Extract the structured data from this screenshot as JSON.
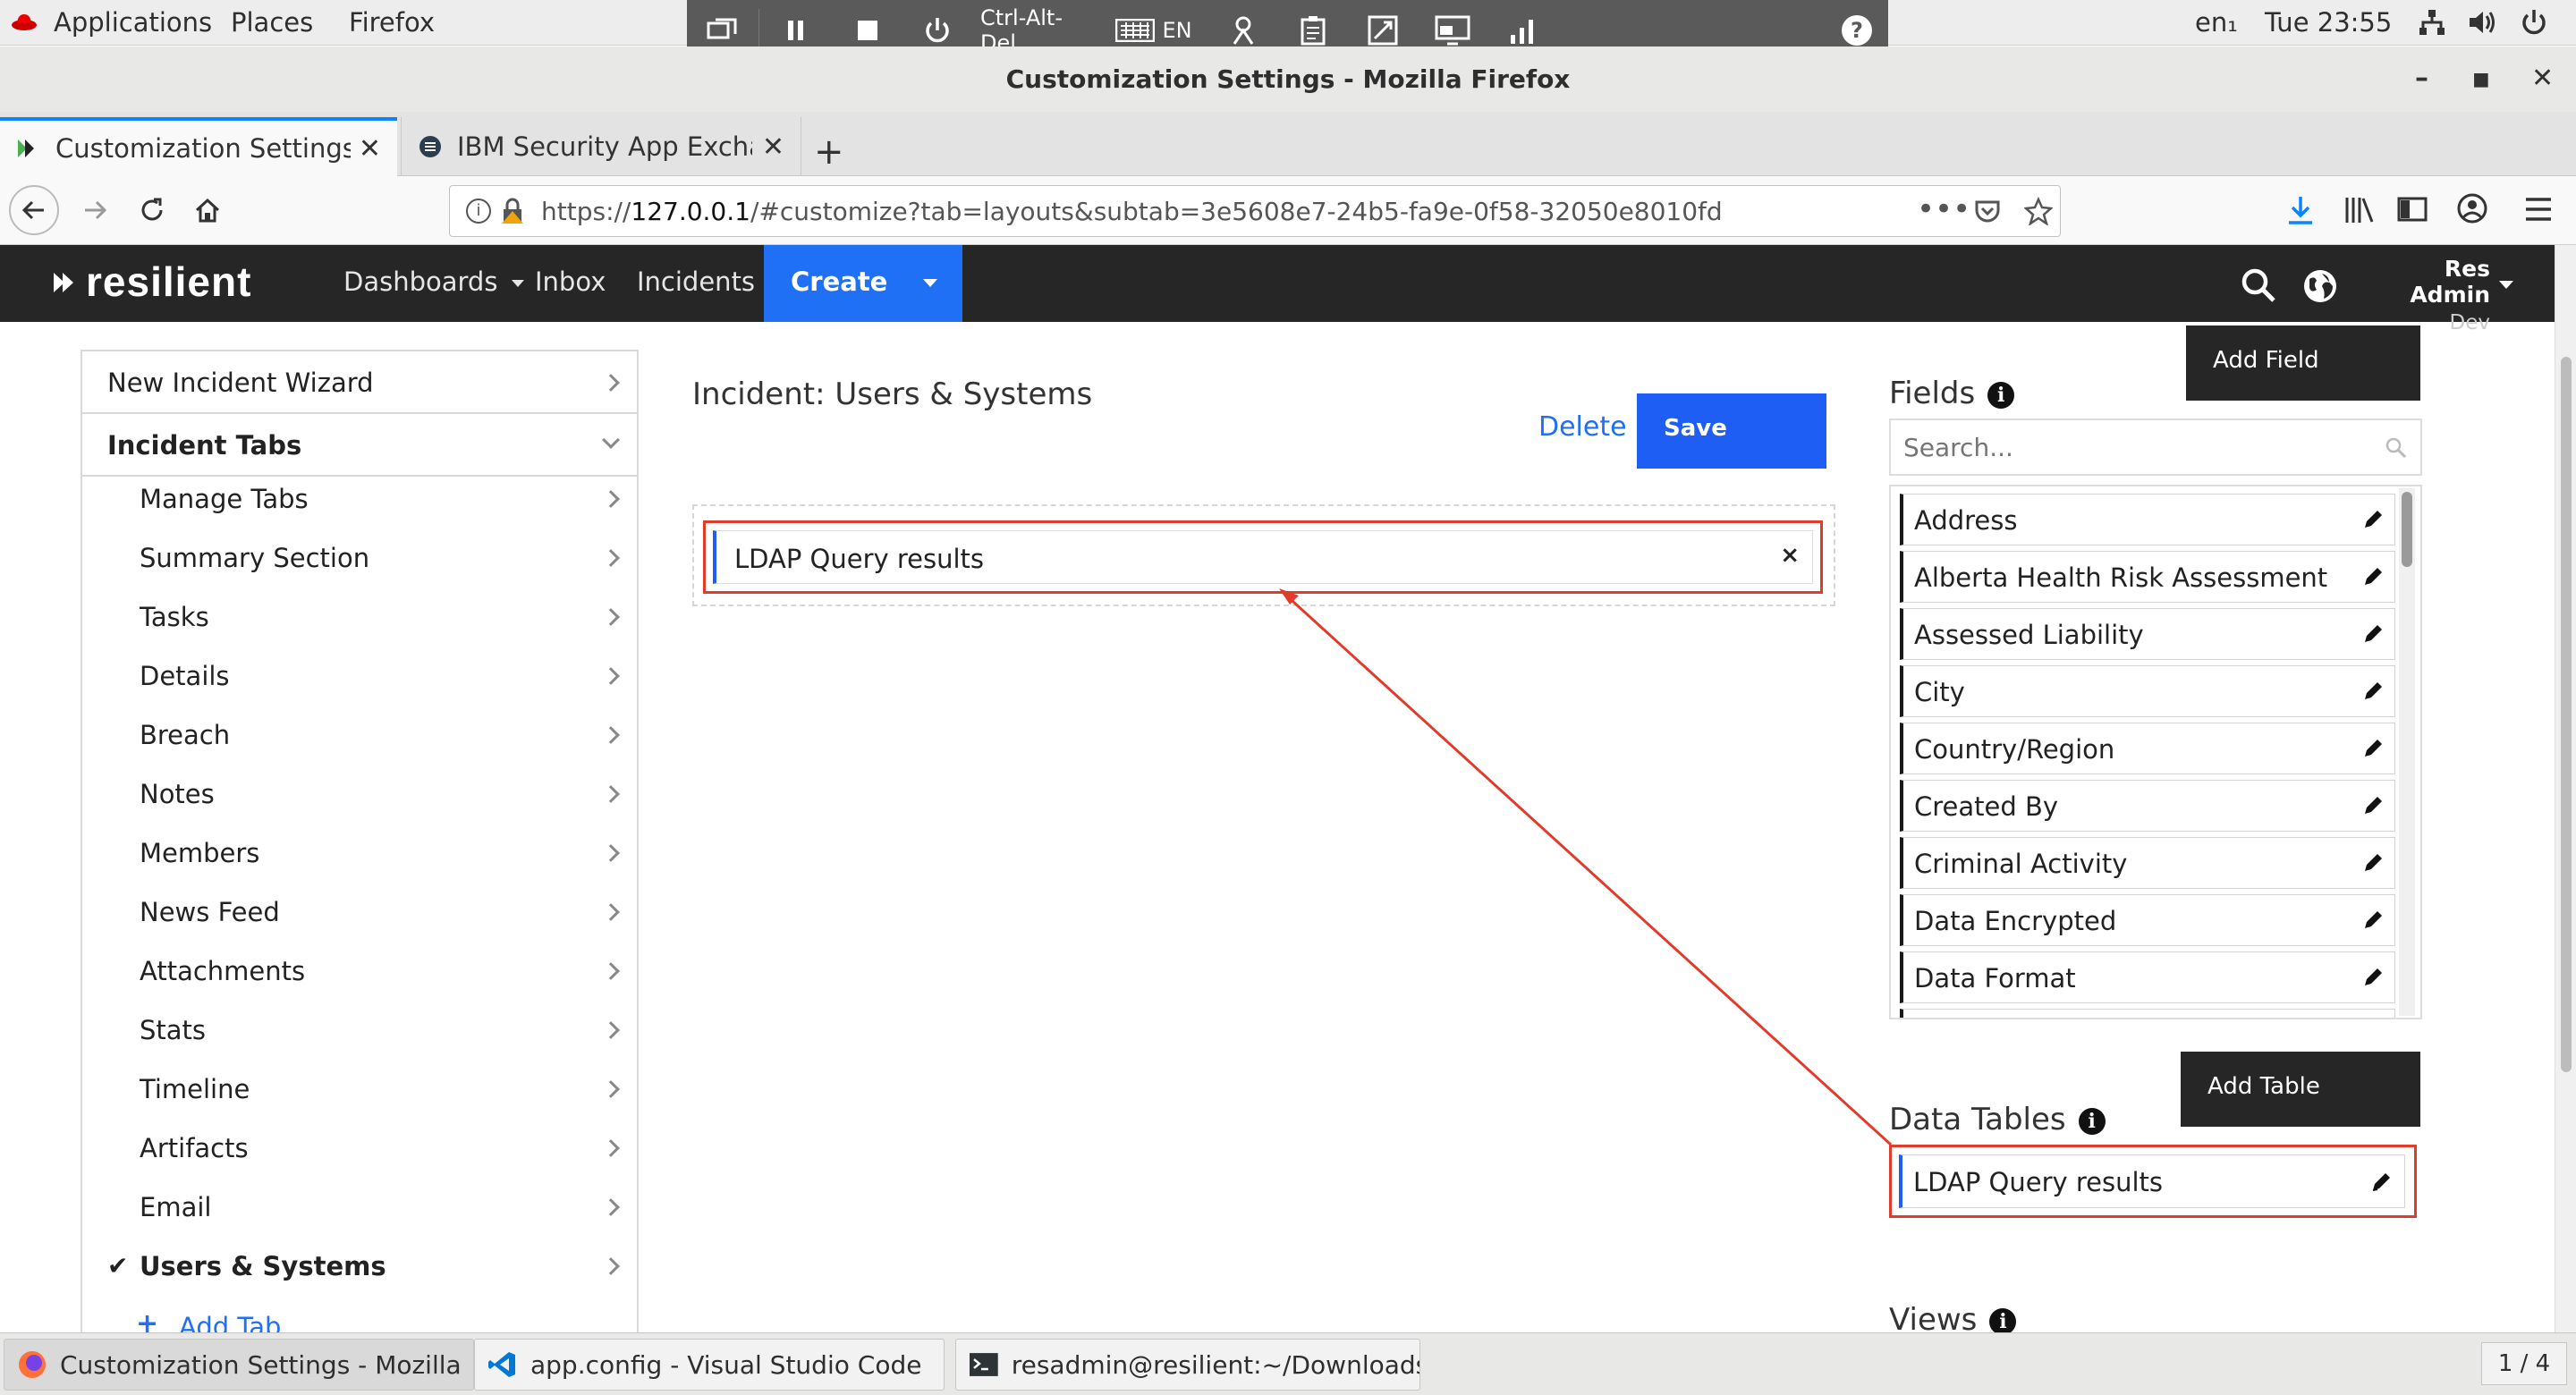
{
  "gnome": {
    "applications": "Applications",
    "places": "Places",
    "firefox": "Firefox",
    "locale": "en₁",
    "clock": "Tue 23:55"
  },
  "vnc": {
    "ctrl_alt_del": "Ctrl-Alt-Del",
    "keyboard_lang": "EN",
    "help": "?"
  },
  "window": {
    "title": "Customization Settings - Mozilla Firefox"
  },
  "tabs": [
    {
      "label": "Customization Settings",
      "active": true
    },
    {
      "label": "IBM Security App Exchange",
      "active": false
    }
  ],
  "url": {
    "prefix": "https://",
    "host": "127.0.0.1",
    "path": "/#customize?tab=layouts&subtab=3e5608e7-24b5-fa9e-0f58-32050e8010fd"
  },
  "app": {
    "logo": "resilient",
    "nav": {
      "dashboards": "Dashboards",
      "inbox": "Inbox",
      "incidents": "Incidents",
      "create": "Create"
    },
    "user": {
      "name": "Res Admin",
      "org": "Dev"
    }
  },
  "sidebar": {
    "new_incident_wizard": "New Incident Wizard",
    "incident_tabs": "Incident Tabs",
    "items": [
      "Manage Tabs",
      "Summary Section",
      "Tasks",
      "Details",
      "Breach",
      "Notes",
      "Members",
      "News Feed",
      "Attachments",
      "Stats",
      "Timeline",
      "Artifacts",
      "Email"
    ],
    "selected": "Users & Systems",
    "add_tab": "Add Tab"
  },
  "center": {
    "title": "Incident: Users & Systems",
    "delete": "Delete",
    "save": "Save",
    "layout_item": "LDAP Query results",
    "remove": "×"
  },
  "right": {
    "add_field": "Add Field",
    "fields_title": "Fields",
    "search_placeholder": "Search...",
    "fields": [
      "Address",
      "Alberta Health Risk Assessment",
      "Assessed Liability",
      "City",
      "Country/Region",
      "Created By",
      "Criminal Activity",
      "Data Encrypted",
      "Data Format"
    ],
    "add_table": "Add Table",
    "data_tables_title": "Data Tables",
    "data_tables": [
      "LDAP Query results"
    ],
    "views_title": "Views"
  },
  "taskbar": {
    "items": [
      "Customization Settings - Mozilla Firefox",
      "app.config - Visual Studio Code",
      "resadmin@resilient:~/Downloads"
    ],
    "workspace": "1 / 4"
  },
  "colors": {
    "accent_blue": "#1f70f4",
    "annotation_red": "#e03b2b",
    "header_dark": "#262626"
  }
}
